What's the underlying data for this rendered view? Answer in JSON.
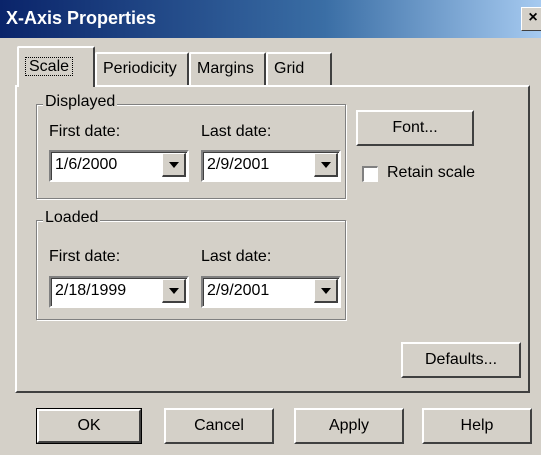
{
  "window": {
    "title": "X-Axis Properties",
    "close_glyph": "×"
  },
  "tabs": [
    {
      "label": "Scale",
      "active": true
    },
    {
      "label": "Periodicity",
      "active": false
    },
    {
      "label": "Margins",
      "active": false
    },
    {
      "label": "Grid",
      "active": false
    }
  ],
  "displayed": {
    "title": "Displayed",
    "first_label": "First date:",
    "last_label": "Last date:",
    "first_value": "1/6/2000",
    "last_value": "2/9/2001"
  },
  "loaded": {
    "title": "Loaded",
    "first_label": "First date:",
    "last_label": "Last date:",
    "first_value": "2/18/1999",
    "last_value": "2/9/2001"
  },
  "font_button": "Font...",
  "retain_scale": {
    "label": "Retain scale",
    "checked": false
  },
  "defaults_button": "Defaults...",
  "footer": {
    "ok": "OK",
    "cancel": "Cancel",
    "apply": "Apply",
    "help": "Help"
  }
}
